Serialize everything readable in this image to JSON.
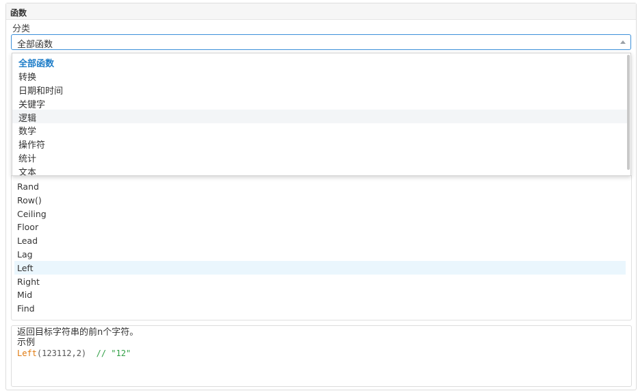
{
  "panel": {
    "title": "函数"
  },
  "category": {
    "label": "分类",
    "selected": "全部函数",
    "options": [
      "全部函数",
      "转换",
      "日期和时间",
      "关键字",
      "逻辑",
      "数学",
      "操作符",
      "统计",
      "文本"
    ],
    "hovered_index": 4
  },
  "functions": {
    "items": [
      "Rand",
      "Row()",
      "Ceiling",
      "Floor",
      "Lead",
      "Lag",
      "Left",
      "Right",
      "Mid",
      "Find"
    ],
    "selected_index": 6
  },
  "description": {
    "summary": "返回目标字符串的前n个字符。",
    "example_label": "示例",
    "example_fn": "Left",
    "example_args": "(123112,2)",
    "example_comment": "// \"12\""
  },
  "colors": {
    "accent": "#1e7dc8",
    "code_function": "#e07a10",
    "code_comment": "#2f9e44",
    "selected_row": "#eaf6fd"
  }
}
